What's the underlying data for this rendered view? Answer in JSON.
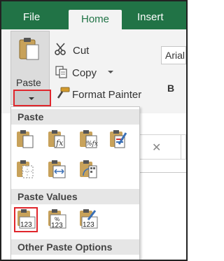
{
  "tabs": {
    "file": "File",
    "home": "Home",
    "insert": "Insert"
  },
  "clipboard": {
    "paste_label": "Paste",
    "cut_label": "Cut",
    "copy_label": "Copy",
    "format_painter_label": "Format Painter"
  },
  "font": {
    "name": "Arial",
    "bold_label": "B"
  },
  "formula_bar": {
    "cancel_glyph": "✕"
  },
  "paste_menu": {
    "paste_header": "Paste",
    "paste_values_header": "Paste Values",
    "other_options_header": "Other Paste Options",
    "paste_options": [
      {
        "icon": "paste-icon"
      },
      {
        "icon": "paste-formulas-icon",
        "glyph": "fx"
      },
      {
        "icon": "paste-formulas-number-formatting-icon",
        "glyph": "%fx"
      },
      {
        "icon": "keep-source-formatting-icon"
      },
      {
        "icon": "no-borders-icon"
      },
      {
        "icon": "keep-source-column-widths-icon"
      },
      {
        "icon": "transpose-icon"
      }
    ],
    "value_options": [
      {
        "icon": "paste-values-icon",
        "glyph": "123",
        "selected": true
      },
      {
        "icon": "values-number-formatting-icon",
        "glyph": "123",
        "sub": "%"
      },
      {
        "icon": "values-source-formatting-icon",
        "glyph": "123"
      }
    ]
  },
  "colors": {
    "excel_green": "#217346",
    "highlight_red": "#e0262c",
    "clipboard_tan": "#c8a25a"
  }
}
